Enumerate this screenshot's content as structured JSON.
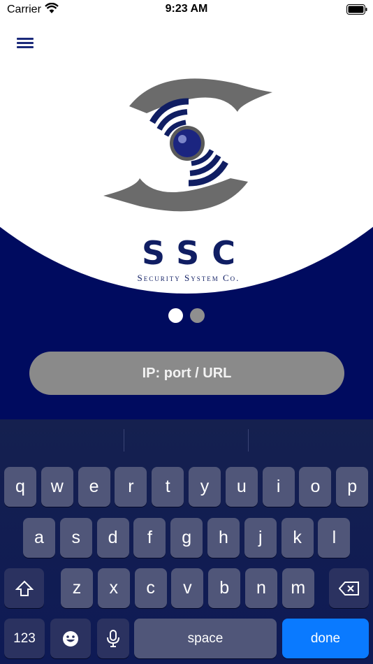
{
  "status_bar": {
    "carrier": "Carrier",
    "time": "9:23 AM"
  },
  "icons": {
    "menu": "menu-icon",
    "wifi": "wifi-icon",
    "battery": "battery-icon",
    "shift": "shift-icon",
    "backspace": "backspace-icon",
    "emoji": "emoji-icon",
    "mic": "microphone-icon"
  },
  "logo": {
    "text": "SSC",
    "subtitle": "Security System Co."
  },
  "pager": {
    "pages": 2,
    "active_index": 0
  },
  "url_input": {
    "placeholder": "IP: port / URL",
    "value": ""
  },
  "keyboard": {
    "row1": [
      "q",
      "w",
      "e",
      "r",
      "t",
      "y",
      "u",
      "i",
      "o",
      "p"
    ],
    "row2": [
      "a",
      "s",
      "d",
      "f",
      "g",
      "h",
      "j",
      "k",
      "l"
    ],
    "row3": [
      "z",
      "x",
      "c",
      "v",
      "b",
      "n",
      "m"
    ],
    "numbers_label": "123",
    "space_label": "space",
    "done_label": "done"
  },
  "colors": {
    "navy": "#000b5f",
    "accent": "#0a7aff",
    "field": "#8a8a8a"
  }
}
